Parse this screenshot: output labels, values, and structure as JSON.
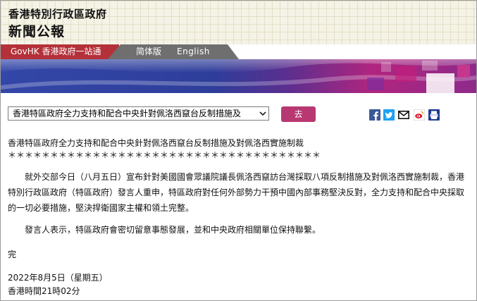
{
  "header": {
    "title_line1": "香港特別行政區政府",
    "title_line2": "新聞公報"
  },
  "nav": {
    "govhk": "GovHK 香港政府一站通",
    "simplified": "简体版",
    "english": "English"
  },
  "toolbar": {
    "selected_article": "香港特區政府全力支持和配合中央針對佩洛西竄台反制措施及",
    "go_label": "去",
    "share_icons": [
      "facebook-icon",
      "twitter-icon",
      "email-icon",
      "weibo-icon",
      "print-icon"
    ]
  },
  "colors": {
    "govhk_red": "#b43139",
    "go_button": "#b83872",
    "facebook": "#3b5998",
    "twitter": "#1da1f2"
  },
  "article": {
    "heading": "香港特區政府全力支持和配合中央針對佩洛西竄台反制措施及對佩洛西實施制裁",
    "separator": "＊＊＊＊＊＊＊＊＊＊＊＊＊＊＊＊＊＊＊＊＊＊＊＊＊＊＊＊＊＊＊＊＊＊＊＊＊",
    "paragraph1": "就外交部今日（八月五日）宣布針對美國國會眾議院議長佩洛西竄訪台灣採取八項反制措施及對佩洛西實施制裁，香港特別行政區政府（特區政府）發言人重申，特區政府對任何外部勢力干預中國內部事務堅決反對，全力支持和配合中央採取的一切必要措施，堅決捍衛國家主權和領土完整。",
    "paragraph2": "發言人表示，特區政府會密切留意事態發展，並和中央政府相關單位保持聯繫。",
    "end_mark": "完",
    "date": "2022年8月5日（星期五）",
    "time": "香港時間21時02分"
  }
}
